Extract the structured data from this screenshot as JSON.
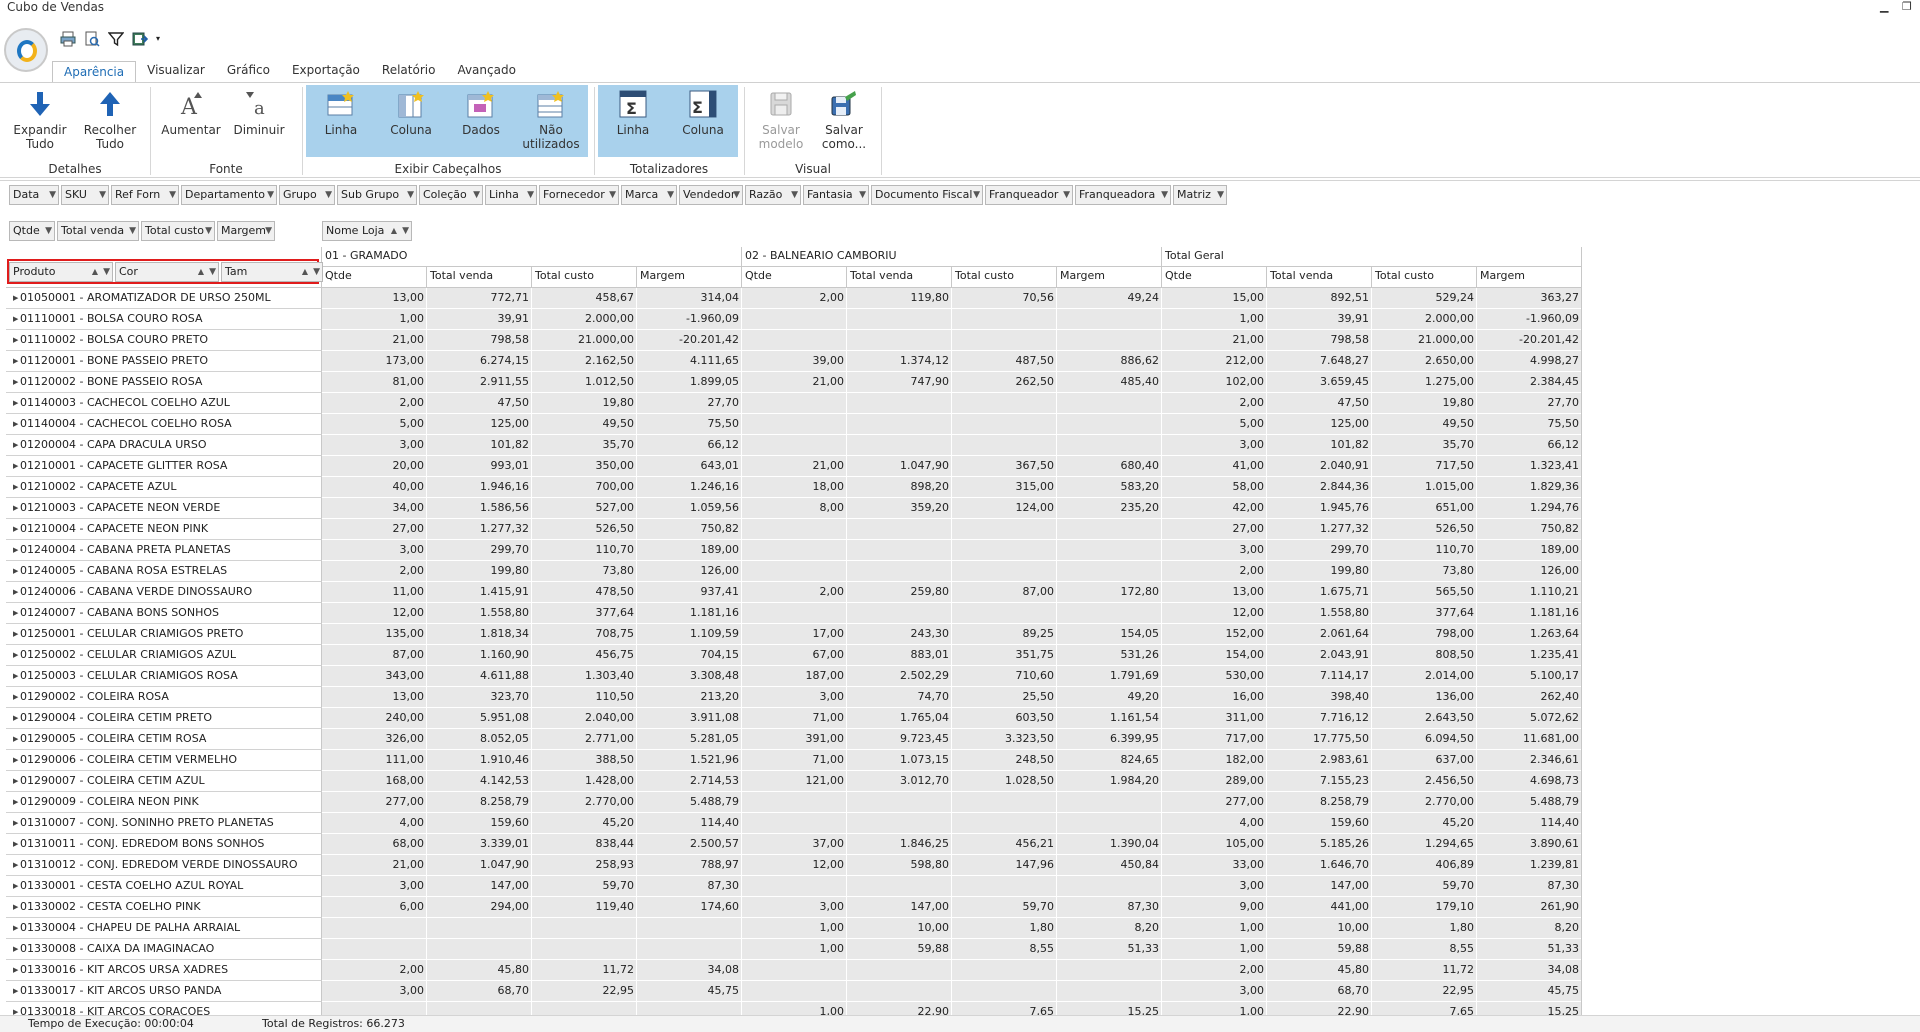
{
  "window": {
    "title": "Cubo de Vendas",
    "minimize": "▁",
    "restore": "❐"
  },
  "tabs": [
    "Aparência",
    "Visualizar",
    "Gráfico",
    "Exportação",
    "Relatório",
    "Avançado"
  ],
  "ribbon": {
    "detalhes": {
      "label": "Detalhes",
      "expand": [
        "Expandir",
        "Tudo"
      ],
      "collapse": [
        "Recolher",
        "Tudo"
      ]
    },
    "fonte": {
      "label": "Fonte",
      "increase": "Aumentar",
      "decrease": "Diminuir"
    },
    "exibir": {
      "label": "Exibir Cabeçalhos",
      "linha": "Linha",
      "coluna": "Coluna",
      "dados": "Dados",
      "nao": [
        "Não",
        "utilizados"
      ]
    },
    "totalizadores": {
      "label": "Totalizadores",
      "linha": "Linha",
      "coluna": "Coluna"
    },
    "visual": {
      "label": "Visual",
      "salvar_modelo": [
        "Salvar",
        "modelo"
      ],
      "salvar_como": [
        "Salvar",
        "como..."
      ]
    }
  },
  "filter_fields": [
    "Data",
    "SKU",
    "Ref Forn",
    "Departamento",
    "Grupo",
    "Sub Grupo",
    "Coleção",
    "Linha",
    "Fornecedor",
    "Marca",
    "Vendedor",
    "Razão",
    "Fantasia",
    "Documento Fiscal",
    "Franqueador",
    "Franqueadora",
    "Matriz"
  ],
  "data_fields": [
    "Qtde",
    "Total venda",
    "Total custo",
    "Margem"
  ],
  "column_field": "Nome Loja",
  "row_fields": [
    "Produto",
    "Cor",
    "Tam"
  ],
  "store_groups": [
    "01 - GRAMADO",
    "02 - BALNEARIO CAMBORIU",
    "Total Geral"
  ],
  "measure_headers": [
    "Qtde",
    "Total venda",
    "Total custo",
    "Margem"
  ],
  "rows": [
    {
      "p": "01050001 - AROMATIZADOR DE URSO 250ML",
      "v": [
        "13,00",
        "772,71",
        "458,67",
        "314,04",
        "2,00",
        "119,80",
        "70,56",
        "49,24",
        "15,00",
        "892,51",
        "529,24",
        "363,27"
      ]
    },
    {
      "p": "01110001 - BOLSA COURO ROSA",
      "v": [
        "1,00",
        "39,91",
        "2.000,00",
        "-1.960,09",
        "",
        "",
        "",
        "",
        "1,00",
        "39,91",
        "2.000,00",
        "-1.960,09"
      ]
    },
    {
      "p": "01110002 - BOLSA COURO PRETO",
      "v": [
        "21,00",
        "798,58",
        "21.000,00",
        "-20.201,42",
        "",
        "",
        "",
        "",
        "21,00",
        "798,58",
        "21.000,00",
        "-20.201,42"
      ]
    },
    {
      "p": "01120001 - BONE PASSEIO PRETO",
      "v": [
        "173,00",
        "6.274,15",
        "2.162,50",
        "4.111,65",
        "39,00",
        "1.374,12",
        "487,50",
        "886,62",
        "212,00",
        "7.648,27",
        "2.650,00",
        "4.998,27"
      ]
    },
    {
      "p": "01120002 - BONE PASSEIO ROSA",
      "v": [
        "81,00",
        "2.911,55",
        "1.012,50",
        "1.899,05",
        "21,00",
        "747,90",
        "262,50",
        "485,40",
        "102,00",
        "3.659,45",
        "1.275,00",
        "2.384,45"
      ]
    },
    {
      "p": "01140003 - CACHECOL COELHO AZUL",
      "v": [
        "2,00",
        "47,50",
        "19,80",
        "27,70",
        "",
        "",
        "",
        "",
        "2,00",
        "47,50",
        "19,80",
        "27,70"
      ]
    },
    {
      "p": "01140004 - CACHECOL COELHO ROSA",
      "v": [
        "5,00",
        "125,00",
        "49,50",
        "75,50",
        "",
        "",
        "",
        "",
        "5,00",
        "125,00",
        "49,50",
        "75,50"
      ]
    },
    {
      "p": "01200004 - CAPA DRACULA URSO",
      "v": [
        "3,00",
        "101,82",
        "35,70",
        "66,12",
        "",
        "",
        "",
        "",
        "3,00",
        "101,82",
        "35,70",
        "66,12"
      ]
    },
    {
      "p": "01210001 - CAPACETE GLITTER ROSA",
      "v": [
        "20,00",
        "993,01",
        "350,00",
        "643,01",
        "21,00",
        "1.047,90",
        "367,50",
        "680,40",
        "41,00",
        "2.040,91",
        "717,50",
        "1.323,41"
      ]
    },
    {
      "p": "01210002 - CAPACETE AZUL",
      "v": [
        "40,00",
        "1.946,16",
        "700,00",
        "1.246,16",
        "18,00",
        "898,20",
        "315,00",
        "583,20",
        "58,00",
        "2.844,36",
        "1.015,00",
        "1.829,36"
      ]
    },
    {
      "p": "01210003 - CAPACETE NEON VERDE",
      "v": [
        "34,00",
        "1.586,56",
        "527,00",
        "1.059,56",
        "8,00",
        "359,20",
        "124,00",
        "235,20",
        "42,00",
        "1.945,76",
        "651,00",
        "1.294,76"
      ]
    },
    {
      "p": "01210004 - CAPACETE NEON PINK",
      "v": [
        "27,00",
        "1.277,32",
        "526,50",
        "750,82",
        "",
        "",
        "",
        "",
        "27,00",
        "1.277,32",
        "526,50",
        "750,82"
      ]
    },
    {
      "p": "01240004 - CABANA PRETA PLANETAS",
      "v": [
        "3,00",
        "299,70",
        "110,70",
        "189,00",
        "",
        "",
        "",
        "",
        "3,00",
        "299,70",
        "110,70",
        "189,00"
      ]
    },
    {
      "p": "01240005 - CABANA ROSA ESTRELAS",
      "v": [
        "2,00",
        "199,80",
        "73,80",
        "126,00",
        "",
        "",
        "",
        "",
        "2,00",
        "199,80",
        "73,80",
        "126,00"
      ]
    },
    {
      "p": "01240006 - CABANA VERDE DINOSSAURO",
      "v": [
        "11,00",
        "1.415,91",
        "478,50",
        "937,41",
        "2,00",
        "259,80",
        "87,00",
        "172,80",
        "13,00",
        "1.675,71",
        "565,50",
        "1.110,21"
      ]
    },
    {
      "p": "01240007 - CABANA BONS SONHOS",
      "v": [
        "12,00",
        "1.558,80",
        "377,64",
        "1.181,16",
        "",
        "",
        "",
        "",
        "12,00",
        "1.558,80",
        "377,64",
        "1.181,16"
      ]
    },
    {
      "p": "01250001 - CELULAR CRIAMIGOS PRETO",
      "v": [
        "135,00",
        "1.818,34",
        "708,75",
        "1.109,59",
        "17,00",
        "243,30",
        "89,25",
        "154,05",
        "152,00",
        "2.061,64",
        "798,00",
        "1.263,64"
      ]
    },
    {
      "p": "01250002 - CELULAR CRIAMIGOS AZUL",
      "v": [
        "87,00",
        "1.160,90",
        "456,75",
        "704,15",
        "67,00",
        "883,01",
        "351,75",
        "531,26",
        "154,00",
        "2.043,91",
        "808,50",
        "1.235,41"
      ]
    },
    {
      "p": "01250003 - CELULAR CRIAMIGOS ROSA",
      "v": [
        "343,00",
        "4.611,88",
        "1.303,40",
        "3.308,48",
        "187,00",
        "2.502,29",
        "710,60",
        "1.791,69",
        "530,00",
        "7.114,17",
        "2.014,00",
        "5.100,17"
      ]
    },
    {
      "p": "01290002 - COLEIRA ROSA",
      "v": [
        "13,00",
        "323,70",
        "110,50",
        "213,20",
        "3,00",
        "74,70",
        "25,50",
        "49,20",
        "16,00",
        "398,40",
        "136,00",
        "262,40"
      ]
    },
    {
      "p": "01290004 - COLEIRA CETIM PRETO",
      "v": [
        "240,00",
        "5.951,08",
        "2.040,00",
        "3.911,08",
        "71,00",
        "1.765,04",
        "603,50",
        "1.161,54",
        "311,00",
        "7.716,12",
        "2.643,50",
        "5.072,62"
      ]
    },
    {
      "p": "01290005 - COLEIRA CETIM ROSA",
      "v": [
        "326,00",
        "8.052,05",
        "2.771,00",
        "5.281,05",
        "391,00",
        "9.723,45",
        "3.323,50",
        "6.399,95",
        "717,00",
        "17.775,50",
        "6.094,50",
        "11.681,00"
      ]
    },
    {
      "p": "01290006 - COLEIRA CETIM VERMELHO",
      "v": [
        "111,00",
        "1.910,46",
        "388,50",
        "1.521,96",
        "71,00",
        "1.073,15",
        "248,50",
        "824,65",
        "182,00",
        "2.983,61",
        "637,00",
        "2.346,61"
      ]
    },
    {
      "p": "01290007 - COLEIRA CETIM AZUL",
      "v": [
        "168,00",
        "4.142,53",
        "1.428,00",
        "2.714,53",
        "121,00",
        "3.012,70",
        "1.028,50",
        "1.984,20",
        "289,00",
        "7.155,23",
        "2.456,50",
        "4.698,73"
      ]
    },
    {
      "p": "01290009 - COLEIRA NEON PINK",
      "v": [
        "277,00",
        "8.258,79",
        "2.770,00",
        "5.488,79",
        "",
        "",
        "",
        "",
        "277,00",
        "8.258,79",
        "2.770,00",
        "5.488,79"
      ]
    },
    {
      "p": "01310007 - CONJ. SONINHO PRETO PLANETAS",
      "v": [
        "4,00",
        "159,60",
        "45,20",
        "114,40",
        "",
        "",
        "",
        "",
        "4,00",
        "159,60",
        "45,20",
        "114,40"
      ]
    },
    {
      "p": "01310011 - CONJ. EDREDOM BONS SONHOS",
      "v": [
        "68,00",
        "3.339,01",
        "838,44",
        "2.500,57",
        "37,00",
        "1.846,25",
        "456,21",
        "1.390,04",
        "105,00",
        "5.185,26",
        "1.294,65",
        "3.890,61"
      ]
    },
    {
      "p": "01310012 - CONJ. EDREDOM VERDE DINOSSAURO",
      "v": [
        "21,00",
        "1.047,90",
        "258,93",
        "788,97",
        "12,00",
        "598,80",
        "147,96",
        "450,84",
        "33,00",
        "1.646,70",
        "406,89",
        "1.239,81"
      ]
    },
    {
      "p": "01330001 - CESTA COELHO AZUL ROYAL",
      "v": [
        "3,00",
        "147,00",
        "59,70",
        "87,30",
        "",
        "",
        "",
        "",
        "3,00",
        "147,00",
        "59,70",
        "87,30"
      ]
    },
    {
      "p": "01330002 - CESTA COELHO PINK",
      "v": [
        "6,00",
        "294,00",
        "119,40",
        "174,60",
        "3,00",
        "147,00",
        "59,70",
        "87,30",
        "9,00",
        "441,00",
        "179,10",
        "261,90"
      ]
    },
    {
      "p": "01330004 - CHAPEU DE PALHA ARRAIAL",
      "v": [
        "",
        "",
        "",
        "",
        "1,00",
        "10,00",
        "1,80",
        "8,20",
        "1,00",
        "10,00",
        "1,80",
        "8,20"
      ]
    },
    {
      "p": "01330008 - CAIXA DA IMAGINACAO",
      "v": [
        "",
        "",
        "",
        "",
        "1,00",
        "59,88",
        "8,55",
        "51,33",
        "1,00",
        "59,88",
        "8,55",
        "51,33"
      ]
    },
    {
      "p": "01330016 - KIT ARCOS URSA XADRES",
      "v": [
        "2,00",
        "45,80",
        "11,72",
        "34,08",
        "",
        "",
        "",
        "",
        "2,00",
        "45,80",
        "11,72",
        "34,08"
      ]
    },
    {
      "p": "01330017 - KIT ARCOS URSO PANDA",
      "v": [
        "3,00",
        "68,70",
        "22,95",
        "45,75",
        "",
        "",
        "",
        "",
        "3,00",
        "68,70",
        "22,95",
        "45,75"
      ]
    },
    {
      "p": "01330018 - KIT ARCOS CORACOES",
      "v": [
        "",
        "",
        "",
        "",
        "1,00",
        "22,90",
        "7,65",
        "15,25",
        "1,00",
        "22,90",
        "7,65",
        "15,25"
      ]
    }
  ],
  "status": {
    "exec": "Tempo de Execução: 00:00:04",
    "total": "Total de Registros: 66.273"
  }
}
